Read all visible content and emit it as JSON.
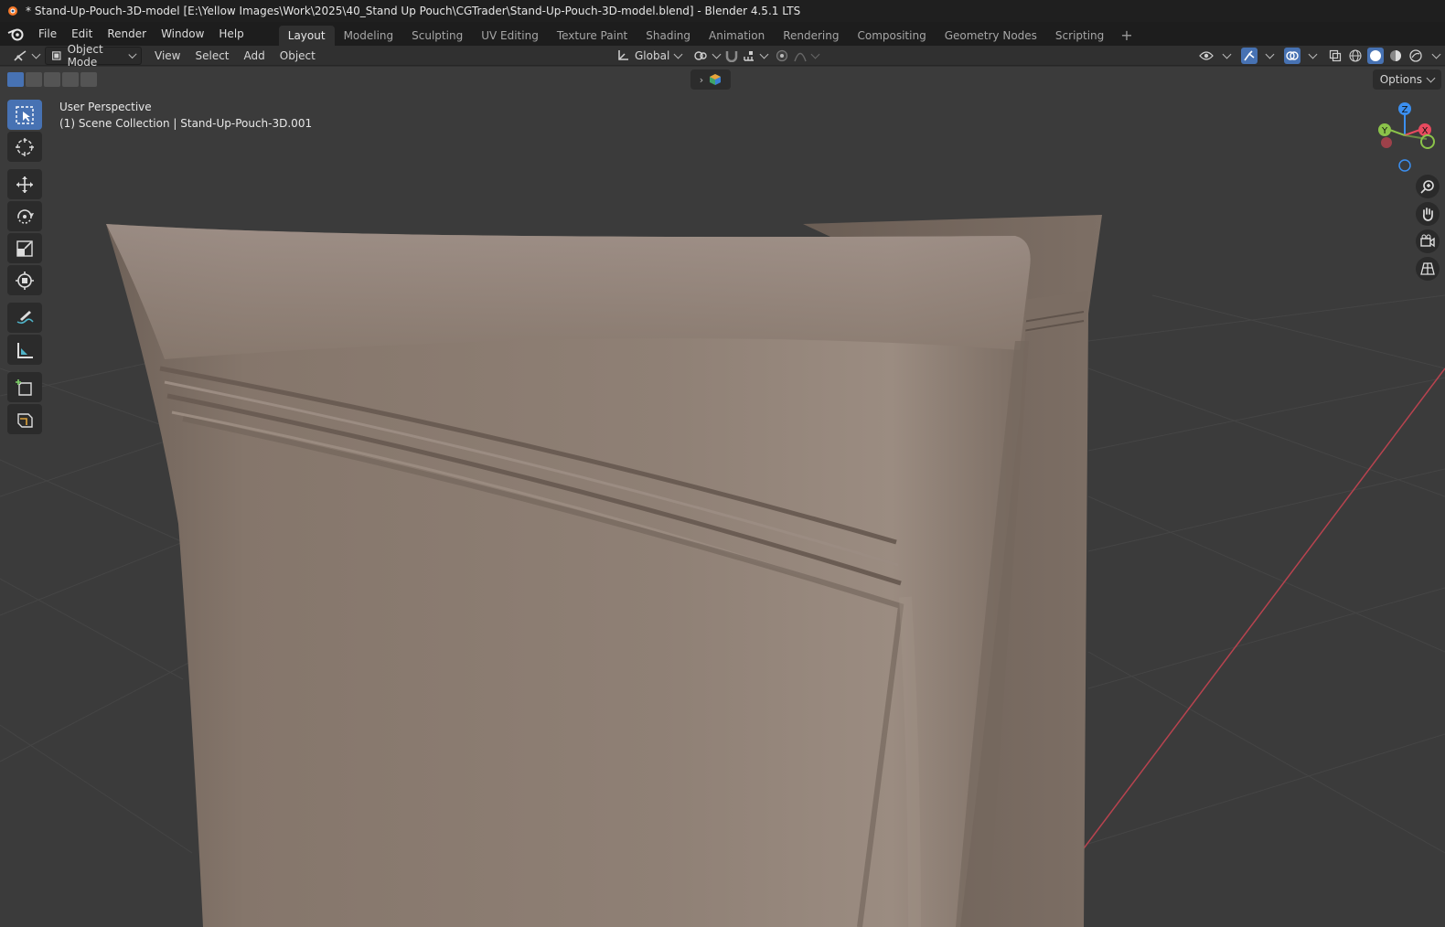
{
  "window": {
    "title": "* Stand-Up-Pouch-3D-model [E:\\Yellow Images\\Work\\2025\\40_Stand Up Pouch\\CGTrader\\Stand-Up-Pouch-3D-model.blend] - Blender 4.5.1 LTS"
  },
  "menu": {
    "items": [
      "File",
      "Edit",
      "Render",
      "Window",
      "Help"
    ]
  },
  "workspaces": {
    "tabs": [
      "Layout",
      "Modeling",
      "Sculpting",
      "UV Editing",
      "Texture Paint",
      "Shading",
      "Animation",
      "Rendering",
      "Compositing",
      "Geometry Nodes",
      "Scripting"
    ],
    "active": "Layout",
    "add_icon": "plus-icon"
  },
  "header": {
    "mode": "Object Mode",
    "menus": [
      "View",
      "Select",
      "Add",
      "Object"
    ],
    "transform_orientation": "Global",
    "options_label": "Options"
  },
  "viewport": {
    "perspective": "User Perspective",
    "collection": "(1) Scene Collection | Stand-Up-Pouch-3D.001"
  },
  "gizmo": {
    "axes": [
      "Z",
      "Y",
      "X"
    ],
    "colors": {
      "x": "#e84a5f",
      "y": "#8bc34a",
      "z": "#3b8ff0"
    }
  },
  "tools": [
    "select-box-icon",
    "cursor-icon",
    "move-icon",
    "rotate-icon",
    "scale-icon",
    "transform-icon",
    "annotate-icon",
    "measure-icon",
    "add-cube-icon",
    "add-primitive-icon"
  ],
  "colors": {
    "accent": "#4772b3",
    "viewport_bg": "#3b3b3b",
    "pouch": "#8a7a6e"
  }
}
